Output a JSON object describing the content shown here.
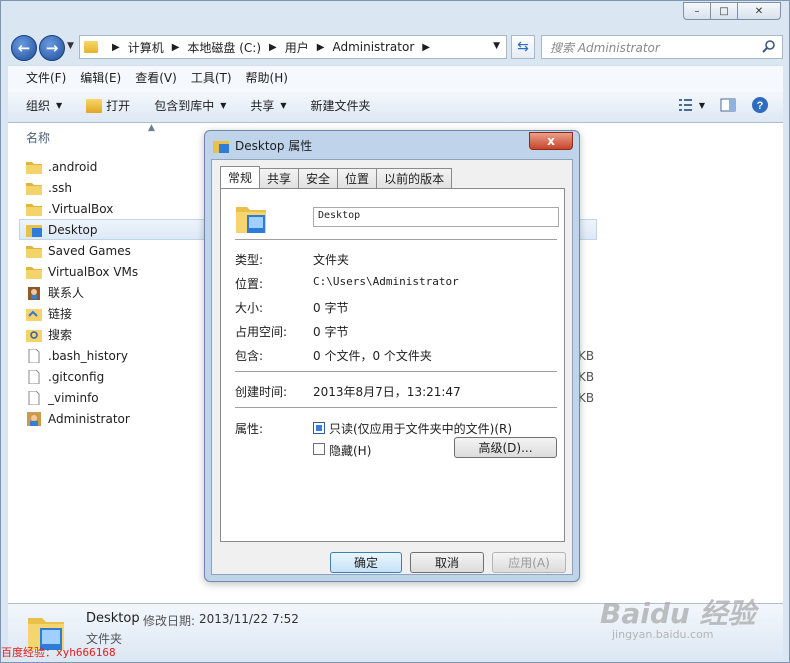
{
  "window": {
    "controls": [
      "–",
      "□",
      "✕"
    ]
  },
  "address": {
    "crumbs": [
      "计算机",
      "本地磁盘 (C:)",
      "用户",
      "Administrator"
    ],
    "search_placeholder": "搜索 Administrator"
  },
  "menu": [
    "文件(F)",
    "编辑(E)",
    "查看(V)",
    "工具(T)",
    "帮助(H)"
  ],
  "commands": {
    "organize": "组织",
    "open": "打开",
    "include_library": "包含到库中",
    "share": "共享",
    "new_folder": "新建文件夹"
  },
  "list": {
    "column_name": "名称",
    "items": [
      {
        "name": ".android",
        "icon": "folder-icon"
      },
      {
        "name": ".ssh",
        "icon": "folder-icon"
      },
      {
        "name": ".VirtualBox",
        "icon": "folder-icon"
      },
      {
        "name": "Desktop",
        "icon": "desktop-folder-icon",
        "selected": true
      },
      {
        "name": "Saved Games",
        "icon": "folder-icon"
      },
      {
        "name": "VirtualBox VMs",
        "icon": "folder-icon"
      },
      {
        "name": "联系人",
        "icon": "contacts-icon"
      },
      {
        "name": "链接",
        "icon": "links-icon"
      },
      {
        "name": "搜索",
        "icon": "search-folder-icon"
      },
      {
        "name": ".bash_history",
        "icon": "file-icon",
        "size": "KB"
      },
      {
        "name": ".gitconfig",
        "icon": "file-icon",
        "size": "KB"
      },
      {
        "name": "_viminfo",
        "icon": "file-icon",
        "size": "KB"
      },
      {
        "name": "Administrator",
        "icon": "shortcut-icon"
      }
    ]
  },
  "status": {
    "name": "Desktop",
    "modified_label": "修改日期:",
    "modified_value": "2013/11/22 7:52",
    "type": "文件夹"
  },
  "dialog": {
    "title": "Desktop 属性",
    "close": "x",
    "tabs": [
      "常规",
      "共享",
      "安全",
      "位置",
      "以前的版本"
    ],
    "folder_name": "Desktop",
    "props": [
      {
        "label": "类型:",
        "value": "文件夹"
      },
      {
        "label": "位置:",
        "value": "C:\\Users\\Administrator"
      },
      {
        "label": "大小:",
        "value": "0 字节"
      },
      {
        "label": "占用空间:",
        "value": "0 字节"
      },
      {
        "label": "包含:",
        "value": "0 个文件，0 个文件夹"
      }
    ],
    "created_label": "创建时间:",
    "created_value": "2013年8月7日，13:21:47",
    "attributes_label": "属性:",
    "readonly_label": "只读(仅应用于文件夹中的文件)(R)",
    "readonly_checked": true,
    "hidden_label": "隐藏(H)",
    "hidden_checked": false,
    "advanced_button": "高级(D)...",
    "ok": "确定",
    "cancel": "取消",
    "apply": "应用(A)"
  },
  "watermark": {
    "credit": "百度经验：xyh666168",
    "logo": "Baidu 经验",
    "url": "jingyan.baidu.com"
  }
}
